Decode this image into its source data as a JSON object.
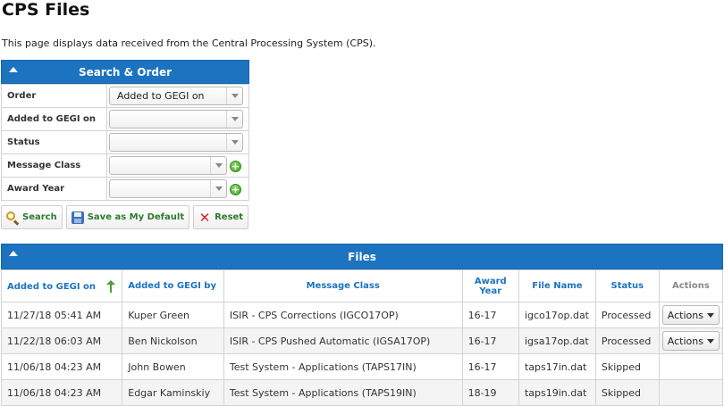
{
  "page": {
    "title": "CPS Files",
    "description": "This page displays data received from the Central Processing System (CPS)."
  },
  "search_panel": {
    "header": "Search & Order",
    "fields": [
      {
        "label": "Order",
        "value": "Added to GEGI on"
      },
      {
        "label": "Added to GEGI on",
        "value": ""
      },
      {
        "label": "Status",
        "value": ""
      },
      {
        "label": "Message Class",
        "value": ""
      },
      {
        "label": "Award Year",
        "value": ""
      }
    ],
    "buttons": {
      "search": "Search",
      "save_default": "Save as My Default",
      "reset": "Reset"
    }
  },
  "files_panel": {
    "header": "Files",
    "columns": [
      "Added to GEGI on",
      "Added to GEGI by",
      "Message Class",
      "Award Year",
      "File Name",
      "Status",
      "Actions"
    ],
    "rows": [
      {
        "added_on": "11/27/18 05:41 AM",
        "added_by": "Kuper Green",
        "message_class": "ISIR - CPS Corrections (IGCO17OP)",
        "award_year": "16-17",
        "file_name": "igco17op.dat",
        "status": "Processed",
        "action": "Actions"
      },
      {
        "added_on": "11/22/18 06:03 AM",
        "added_by": "Ben Nickolson",
        "message_class": "ISIR - CPS Pushed Automatic (IGSA17OP)",
        "award_year": "16-17",
        "file_name": "igsa17op.dat",
        "status": "Processed",
        "action": "Actions"
      },
      {
        "added_on": "11/06/18 04:23 AM",
        "added_by": "John Bowen",
        "message_class": "Test System - Applications (TAPS17IN)",
        "award_year": "16-17",
        "file_name": "taps17in.dat",
        "status": "Skipped",
        "action": ""
      },
      {
        "added_on": "11/06/18 04:23 AM",
        "added_by": "Edgar Kaminskiy",
        "message_class": "Test System - Applications (TAPS19IN)",
        "award_year": "18-19",
        "file_name": "taps19in.dat",
        "status": "Skipped",
        "action": ""
      }
    ]
  },
  "colors": {
    "header_blue": "#1c73c0",
    "button_text_green": "#2e7a2e",
    "reset_red": "#d82222"
  },
  "icons": [
    "collapse-icon",
    "plus-icon",
    "search-icon",
    "save-icon",
    "reset-icon",
    "sort-ascending-icon",
    "dropdown-arrow-icon"
  ]
}
